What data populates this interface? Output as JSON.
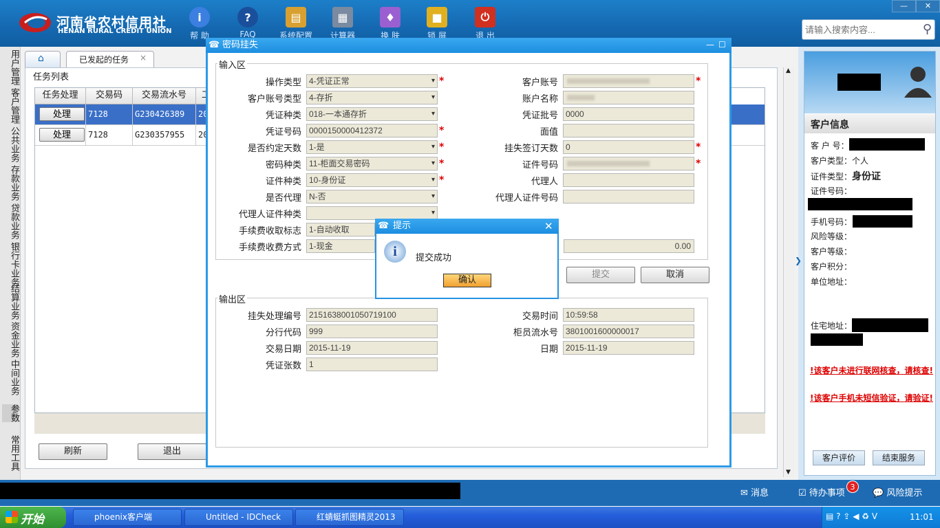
{
  "app": {
    "logo_cn": "河南省农村信用社",
    "logo_en": "HENAN RURAL CREDIT UNION"
  },
  "toolbar": [
    "帮 助",
    "FAQ",
    "系统配置",
    "计算器",
    "换 肤",
    "锁 屏",
    "退 出"
  ],
  "search": {
    "placeholder": "请输入搜索内容..."
  },
  "leftnav": [
    "用户管理",
    "客户管理",
    "公共业务",
    "存款业务",
    "贷款业务",
    "银行卡业务",
    "结算业务",
    "资金业务",
    "中间业务",
    "参数",
    "常用工具"
  ],
  "tabs": {
    "active": "已发起的任务"
  },
  "tasks": {
    "title": "任务列表",
    "columns": [
      "任务处理",
      "交易码",
      "交易流水号",
      "工"
    ],
    "rows": [
      {
        "action": "处理",
        "code": "7128",
        "serial": "G230426389",
        "extra": "20"
      },
      {
        "action": "处理",
        "code": "7128",
        "serial": "G230357955",
        "extra": "20"
      }
    ],
    "refresh": "刷新",
    "exit": "退出"
  },
  "dialog": {
    "title": "密码挂失",
    "input_legend": "输入区",
    "output_legend": "输出区",
    "left_fields": [
      {
        "label": "操作类型",
        "value": "4-凭证正常",
        "dd": true,
        "req": true
      },
      {
        "label": "客户账号类型",
        "value": "4-存折",
        "dd": true,
        "req": false
      },
      {
        "label": "凭证种类",
        "value": "018-一本通存折",
        "dd": true,
        "req": false
      },
      {
        "label": "凭证号码",
        "value": "0000150000412372",
        "dd": false,
        "req": true
      },
      {
        "label": "是否约定天数",
        "value": "1-是",
        "dd": true,
        "req": true
      },
      {
        "label": "密码种类",
        "value": "11-柜面交易密码",
        "dd": true,
        "req": true
      },
      {
        "label": "证件种类",
        "value": "10-身份证",
        "dd": true,
        "req": true
      },
      {
        "label": "是否代理",
        "value": "N-否",
        "dd": true,
        "req": false
      },
      {
        "label": "代理人证件种类",
        "value": "",
        "dd": true,
        "req": false
      },
      {
        "label": "手续费收取标志",
        "value": "1-自动收取",
        "dd": false,
        "req": false
      },
      {
        "label": "手续费收费方式",
        "value": "1-现金",
        "dd": false,
        "req": false
      }
    ],
    "right_fields": [
      {
        "label": "客户账号",
        "value": "",
        "blur": true,
        "req": true
      },
      {
        "label": "账户名称",
        "value": "",
        "blur": true,
        "req": false
      },
      {
        "label": "凭证批号",
        "value": "0000",
        "blur": false,
        "req": false
      },
      {
        "label": "面值",
        "value": "",
        "blur": false,
        "req": false
      },
      {
        "label": "挂失签订天数",
        "value": "0",
        "blur": false,
        "req": true
      },
      {
        "label": "证件号码",
        "value": "",
        "blur": true,
        "req": true
      },
      {
        "label": "代理人",
        "value": "",
        "blur": false,
        "req": false
      },
      {
        "label": "代理人证件号码",
        "value": "",
        "blur": false,
        "req": false
      }
    ],
    "fee_value": "0.00",
    "submit": "提交",
    "cancel": "取消",
    "out_left": [
      {
        "label": "挂失处理编号",
        "value": "2151638001050719100"
      },
      {
        "label": "分行代码",
        "value": "999"
      },
      {
        "label": "交易日期",
        "value": "2015-11-19"
      },
      {
        "label": "凭证张数",
        "value": "1"
      }
    ],
    "out_right": [
      {
        "label": "交易时间",
        "value": "10:59:58"
      },
      {
        "label": "柜员流水号",
        "value": "3801001600000017"
      },
      {
        "label": "日期",
        "value": "2015-11-19"
      }
    ]
  },
  "tip": {
    "title": "提示",
    "message": "提交成功",
    "ok": "确认"
  },
  "customer": {
    "title": "客户信息",
    "no": "客 户 号：",
    "type_label": "客户类型：",
    "type_value": "个人",
    "id_type_label": "证件类型：",
    "id_type_value": "身份证",
    "id_no": "证件号码：",
    "phone": "手机号码：",
    "risk": "风险等级：",
    "level": "客户等级：",
    "points": "客户积分：",
    "unit": "单位地址：",
    "home": "住宅地址：",
    "warn1": "!该客户未进行联网核查，请核查!",
    "warn2": "!该客户手机未短信验证，请验证!",
    "eval": "客户评价",
    "end": "结束服务"
  },
  "statusbar": {
    "msg": "消息",
    "todo": "待办事项",
    "todo_count": "3",
    "risk": "风险提示"
  },
  "taskbar": {
    "start": "开始",
    "items": [
      "phoenix客户端",
      "Untitled - IDCheck",
      "红蜻蜓抓图精灵2013"
    ],
    "clock": "11:01"
  },
  "colors": {
    "brand": "#1568b0",
    "dialog_border": "#2b9ae6",
    "required": "#d00000"
  }
}
